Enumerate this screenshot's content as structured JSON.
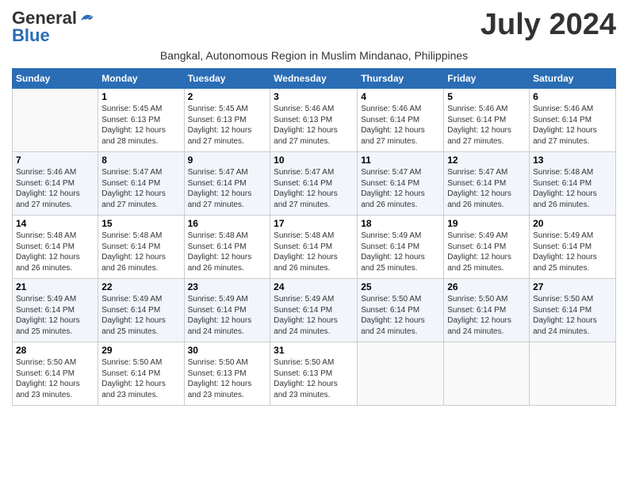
{
  "logo": {
    "general": "General",
    "blue": "Blue"
  },
  "header": {
    "month": "July 2024",
    "location": "Bangkal, Autonomous Region in Muslim Mindanao, Philippines"
  },
  "columns": [
    "Sunday",
    "Monday",
    "Tuesday",
    "Wednesday",
    "Thursday",
    "Friday",
    "Saturday"
  ],
  "weeks": [
    [
      {
        "day": "",
        "info": ""
      },
      {
        "day": "1",
        "info": "Sunrise: 5:45 AM\nSunset: 6:13 PM\nDaylight: 12 hours\nand 28 minutes."
      },
      {
        "day": "2",
        "info": "Sunrise: 5:45 AM\nSunset: 6:13 PM\nDaylight: 12 hours\nand 27 minutes."
      },
      {
        "day": "3",
        "info": "Sunrise: 5:46 AM\nSunset: 6:13 PM\nDaylight: 12 hours\nand 27 minutes."
      },
      {
        "day": "4",
        "info": "Sunrise: 5:46 AM\nSunset: 6:14 PM\nDaylight: 12 hours\nand 27 minutes."
      },
      {
        "day": "5",
        "info": "Sunrise: 5:46 AM\nSunset: 6:14 PM\nDaylight: 12 hours\nand 27 minutes."
      },
      {
        "day": "6",
        "info": "Sunrise: 5:46 AM\nSunset: 6:14 PM\nDaylight: 12 hours\nand 27 minutes."
      }
    ],
    [
      {
        "day": "7",
        "info": "Sunrise: 5:46 AM\nSunset: 6:14 PM\nDaylight: 12 hours\nand 27 minutes."
      },
      {
        "day": "8",
        "info": "Sunrise: 5:47 AM\nSunset: 6:14 PM\nDaylight: 12 hours\nand 27 minutes."
      },
      {
        "day": "9",
        "info": "Sunrise: 5:47 AM\nSunset: 6:14 PM\nDaylight: 12 hours\nand 27 minutes."
      },
      {
        "day": "10",
        "info": "Sunrise: 5:47 AM\nSunset: 6:14 PM\nDaylight: 12 hours\nand 27 minutes."
      },
      {
        "day": "11",
        "info": "Sunrise: 5:47 AM\nSunset: 6:14 PM\nDaylight: 12 hours\nand 26 minutes."
      },
      {
        "day": "12",
        "info": "Sunrise: 5:47 AM\nSunset: 6:14 PM\nDaylight: 12 hours\nand 26 minutes."
      },
      {
        "day": "13",
        "info": "Sunrise: 5:48 AM\nSunset: 6:14 PM\nDaylight: 12 hours\nand 26 minutes."
      }
    ],
    [
      {
        "day": "14",
        "info": "Sunrise: 5:48 AM\nSunset: 6:14 PM\nDaylight: 12 hours\nand 26 minutes."
      },
      {
        "day": "15",
        "info": "Sunrise: 5:48 AM\nSunset: 6:14 PM\nDaylight: 12 hours\nand 26 minutes."
      },
      {
        "day": "16",
        "info": "Sunrise: 5:48 AM\nSunset: 6:14 PM\nDaylight: 12 hours\nand 26 minutes."
      },
      {
        "day": "17",
        "info": "Sunrise: 5:48 AM\nSunset: 6:14 PM\nDaylight: 12 hours\nand 26 minutes."
      },
      {
        "day": "18",
        "info": "Sunrise: 5:49 AM\nSunset: 6:14 PM\nDaylight: 12 hours\nand 25 minutes."
      },
      {
        "day": "19",
        "info": "Sunrise: 5:49 AM\nSunset: 6:14 PM\nDaylight: 12 hours\nand 25 minutes."
      },
      {
        "day": "20",
        "info": "Sunrise: 5:49 AM\nSunset: 6:14 PM\nDaylight: 12 hours\nand 25 minutes."
      }
    ],
    [
      {
        "day": "21",
        "info": "Sunrise: 5:49 AM\nSunset: 6:14 PM\nDaylight: 12 hours\nand 25 minutes."
      },
      {
        "day": "22",
        "info": "Sunrise: 5:49 AM\nSunset: 6:14 PM\nDaylight: 12 hours\nand 25 minutes."
      },
      {
        "day": "23",
        "info": "Sunrise: 5:49 AM\nSunset: 6:14 PM\nDaylight: 12 hours\nand 24 minutes."
      },
      {
        "day": "24",
        "info": "Sunrise: 5:49 AM\nSunset: 6:14 PM\nDaylight: 12 hours\nand 24 minutes."
      },
      {
        "day": "25",
        "info": "Sunrise: 5:50 AM\nSunset: 6:14 PM\nDaylight: 12 hours\nand 24 minutes."
      },
      {
        "day": "26",
        "info": "Sunrise: 5:50 AM\nSunset: 6:14 PM\nDaylight: 12 hours\nand 24 minutes."
      },
      {
        "day": "27",
        "info": "Sunrise: 5:50 AM\nSunset: 6:14 PM\nDaylight: 12 hours\nand 24 minutes."
      }
    ],
    [
      {
        "day": "28",
        "info": "Sunrise: 5:50 AM\nSunset: 6:14 PM\nDaylight: 12 hours\nand 23 minutes."
      },
      {
        "day": "29",
        "info": "Sunrise: 5:50 AM\nSunset: 6:14 PM\nDaylight: 12 hours\nand 23 minutes."
      },
      {
        "day": "30",
        "info": "Sunrise: 5:50 AM\nSunset: 6:13 PM\nDaylight: 12 hours\nand 23 minutes."
      },
      {
        "day": "31",
        "info": "Sunrise: 5:50 AM\nSunset: 6:13 PM\nDaylight: 12 hours\nand 23 minutes."
      },
      {
        "day": "",
        "info": ""
      },
      {
        "day": "",
        "info": ""
      },
      {
        "day": "",
        "info": ""
      }
    ]
  ]
}
